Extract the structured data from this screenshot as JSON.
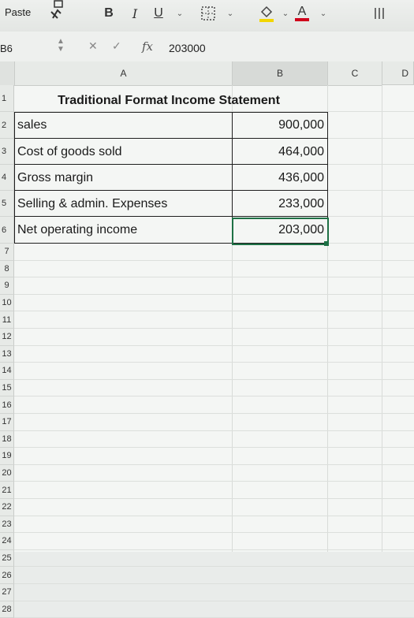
{
  "ribbon": {
    "paste_label": "Paste",
    "bold_label": "B",
    "italic_label": "I",
    "underline_label": "U",
    "font_color_label": "A",
    "icons": [
      "paste-icon",
      "format-painter-icon",
      "bold-icon",
      "italic-icon",
      "underline-icon",
      "borders-icon",
      "fill-color-icon",
      "font-color-icon",
      "align-icon"
    ]
  },
  "formula_bar": {
    "name_box": "B6",
    "fx_label": "fx",
    "value": "203000"
  },
  "columns": [
    "A",
    "B",
    "C",
    "D"
  ],
  "rows": [
    "1",
    "2",
    "3",
    "4",
    "5",
    "6",
    "7",
    "8",
    "9",
    "10",
    "11",
    "12",
    "13",
    "14",
    "15",
    "16",
    "17",
    "18",
    "19",
    "20",
    "21",
    "22",
    "23",
    "24",
    "25",
    "26",
    "27",
    "28"
  ],
  "sheet": {
    "title": "Traditional Format Income Statement",
    "items": [
      {
        "label": "sales",
        "value": "900,000"
      },
      {
        "label": "Cost of goods sold",
        "value": "464,000"
      },
      {
        "label": "Gross margin",
        "value": "436,000"
      },
      {
        "label": "Selling & admin. Expenses",
        "value": "233,000"
      },
      {
        "label": "Net operating income",
        "value": "203,000"
      }
    ]
  },
  "colors": {
    "selection": "#1e7145",
    "highlight_underline": "#f2d600",
    "font_color_underline": "#d0021b"
  }
}
